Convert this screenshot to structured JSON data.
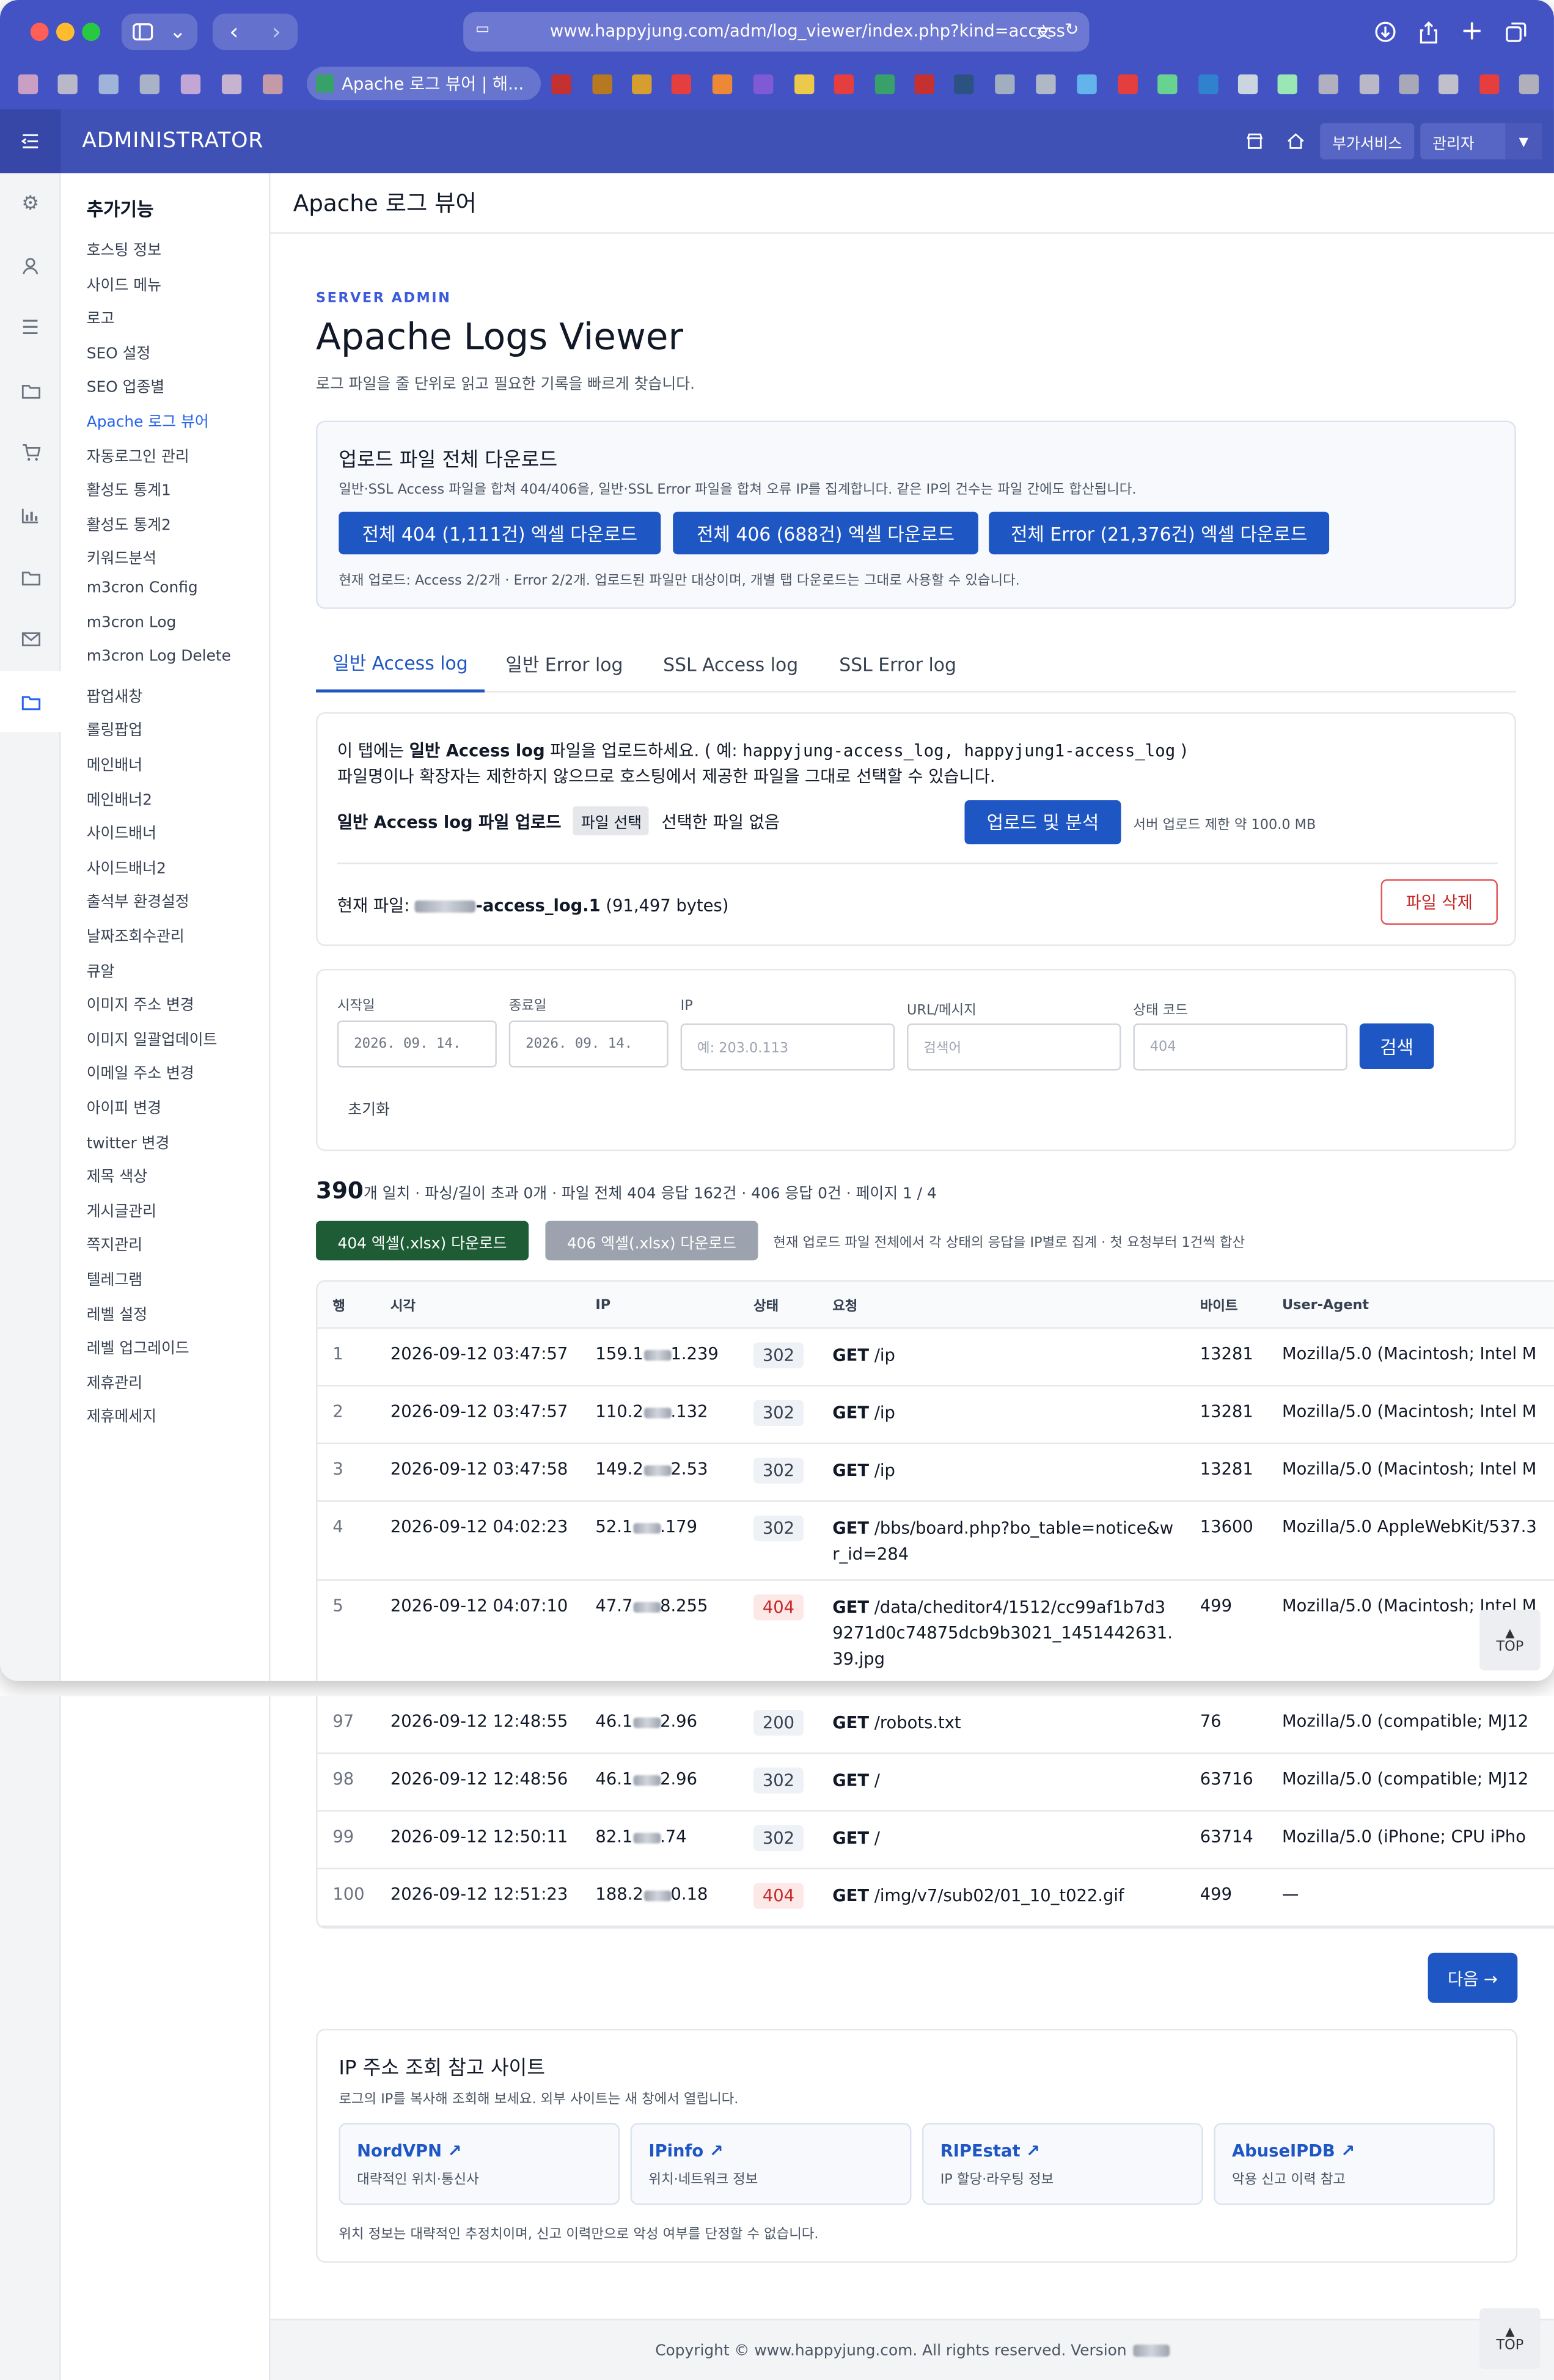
{
  "browser": {
    "url": "www.happyjung.com/adm/log_viewer/index.php?kind=access",
    "active_tab": "Apache 로그 뷰어 | 해..."
  },
  "admin": {
    "title": "ADMINISTRATOR",
    "services_label": "부가서비스",
    "user_label": "관리자"
  },
  "sidebar": {
    "heading": "추가기능",
    "items": [
      "호스팅 정보",
      "사이드 메뉴",
      "로고",
      "SEO 설정",
      "SEO 업종별",
      "Apache 로그 뷰어",
      "자동로그인 관리",
      "활성도 통계1",
      "활성도 통계2",
      "키워드분석",
      "m3cron Config",
      "m3cron Log",
      "m3cron Log Delete",
      "팝업새창",
      "롤링팝업",
      "메인배너",
      "메인배너2",
      "사이드배너",
      "사이드배너2",
      "출석부 환경설정",
      "날짜조회수관리",
      "큐알",
      "이미지 주소 변경",
      "이미지 일괄업데이트",
      "이메일 주소 변경",
      "아이피 변경",
      "twitter 변경",
      "제목 색상",
      "게시글관리",
      "쪽지관리",
      "텔레그램",
      "레벨 설정",
      "레벨 업그레이드",
      "제휴관리",
      "제휴메세지"
    ],
    "active_index": 5
  },
  "page": {
    "header_title": "Apache 로그 뷰어",
    "kicker": "SERVER ADMIN",
    "title": "Apache Logs Viewer",
    "lead": "로그 파일을 줄 단위로 읽고 필요한 기록을 빠르게 찾습니다."
  },
  "download_all": {
    "title": "업로드 파일 전체 다운로드",
    "desc": "일반·SSL Access 파일을 합쳐 404/406을, 일반·SSL Error 파일을 합쳐 오류 IP를 집계합니다. 같은 IP의 건수는 파일 간에도 합산됩니다.",
    "btn_404": "전체 404 (1,111건) 엑셀 다운로드",
    "btn_406": "전체 406 (688건) 엑셀 다운로드",
    "btn_error": "전체 Error (21,376건) 엑셀 다운로드",
    "note": "현재 업로드: Access 2/2개 · Error 2/2개. 업로드된 파일만 대상이며, 개별 탭 다운로드는 그대로 사용할 수 있습니다."
  },
  "tabs": [
    "일반 Access log",
    "일반 Error log",
    "SSL Access log",
    "SSL Error log"
  ],
  "upload": {
    "line1_pre": "이 탭에는 ",
    "line1_bold": "일반 Access log",
    "line1_mid": " 파일을 업로드하세요. ( 예: ",
    "line1_mono": "happyjung-access_log, happyjung1-access_log",
    "line1_post": " )",
    "line2": "파일명이나 확장자는 제한하지 않으므로 호스팅에서 제공한 파일을 그대로 선택할 수 있습니다.",
    "label": "일반 Access log 파일 업로드",
    "file_button": "파일 선택",
    "no_file": "선택한 파일 없음",
    "submit": "업로드 및 분석",
    "limit": "서버 업로드 제한 약 100.0 MB",
    "current_label": "현재 파일: ",
    "current_file": "-access_log.1",
    "current_size": " (91,497 bytes)",
    "delete": "파일 삭제"
  },
  "filters": {
    "start_label": "시작일",
    "start_value": "2026. 09. 14.",
    "end_label": "종료일",
    "end_value": "2026. 09. 14.",
    "ip_label": "IP",
    "ip_placeholder": "예: 203.0.113",
    "url_label": "URL/메시지",
    "url_placeholder": "검색어",
    "status_label": "상태 코드",
    "status_placeholder": "404",
    "search": "검색",
    "reset": "초기화"
  },
  "summary": {
    "count": "390",
    "text": "개 일치 · 파싱/길이 초과 0개 · 파일 전체 404 응답 162건 · 406 응답 0건 · 페이지 1 / 4"
  },
  "excel": {
    "btn_404": "404 엑셀(.xlsx) 다운로드",
    "btn_406": "406 엑셀(.xlsx) 다운로드",
    "note": "현재 업로드 파일 전체에서 각 상태의 응답을 IP별로 집계 · 첫 요청부터 1건씩 합산"
  },
  "table": {
    "headers": [
      "행",
      "시각",
      "IP",
      "상태",
      "요청",
      "바이트",
      "User-Agent"
    ],
    "rows_top": [
      {
        "idx": "1",
        "time": "2026-09-12 03:47:57",
        "ip_a": "159.1",
        "ip_b": "1.239",
        "status": "302",
        "method": "GET",
        "path": "/ip",
        "bytes": "13281",
        "ua": "Mozilla/5.0 (Macintosh; Intel M"
      },
      {
        "idx": "2",
        "time": "2026-09-12 03:47:57",
        "ip_a": "110.2",
        "ip_b": ".132",
        "status": "302",
        "method": "GET",
        "path": "/ip",
        "bytes": "13281",
        "ua": "Mozilla/5.0 (Macintosh; Intel M"
      },
      {
        "idx": "3",
        "time": "2026-09-12 03:47:58",
        "ip_a": "149.2",
        "ip_b": "2.53",
        "status": "302",
        "method": "GET",
        "path": "/ip",
        "bytes": "13281",
        "ua": "Mozilla/5.0 (Macintosh; Intel M"
      },
      {
        "idx": "4",
        "time": "2026-09-12 04:02:23",
        "ip_a": "52.1",
        "ip_b": ".179",
        "status": "302",
        "method": "GET",
        "path": "/bbs/board.php?bo_table=notice&wr_id=284",
        "bytes": "13600",
        "ua": "Mozilla/5.0 AppleWebKit/537.3"
      },
      {
        "idx": "5",
        "time": "2026-09-12 04:07:10",
        "ip_a": "47.7",
        "ip_b": "8.255",
        "status": "404",
        "method": "GET",
        "path": "/data/cheditor4/1512/cc99af1b7d39271d0c74875dcb9b3021_1451442631.39.jpg",
        "bytes": "499",
        "ua": "Mozilla/5.0 (Macintosh; Intel M"
      }
    ],
    "rows_bottom": [
      {
        "idx": "97",
        "time": "2026-09-12 12:48:55",
        "ip_a": "46.1",
        "ip_b": "2.96",
        "status": "200",
        "method": "GET",
        "path": "/robots.txt",
        "bytes": "76",
        "ua": "Mozilla/5.0 (compatible; MJ12"
      },
      {
        "idx": "98",
        "time": "2026-09-12 12:48:56",
        "ip_a": "46.1",
        "ip_b": "2.96",
        "status": "302",
        "method": "GET",
        "path": "/",
        "bytes": "63716",
        "ua": "Mozilla/5.0 (compatible; MJ12"
      },
      {
        "idx": "99",
        "time": "2026-09-12 12:50:11",
        "ip_a": "82.1",
        "ip_b": ".74",
        "status": "302",
        "method": "GET",
        "path": "/",
        "bytes": "63714",
        "ua": "Mozilla/5.0 (iPhone; CPU iPho"
      },
      {
        "idx": "100",
        "time": "2026-09-12 12:51:23",
        "ip_a": "188.2",
        "ip_b": "0.18",
        "status": "404",
        "method": "GET",
        "path": "/img/v7/sub02/01_10_t022.gif",
        "bytes": "499",
        "ua": "—"
      }
    ]
  },
  "next_label": "다음 →",
  "top_label": "TOP",
  "ip_ref": {
    "title": "IP 주소 조회 참고 사이트",
    "desc": "로그의 IP를 복사해 조회해 보세요. 외부 사이트는 새 창에서 열립니다.",
    "sites": [
      {
        "name": "NordVPN ↗",
        "sub": "대략적인 위치·통신사"
      },
      {
        "name": "IPinfo ↗",
        "sub": "위치·네트워크 정보"
      },
      {
        "name": "RIPEstat ↗",
        "sub": "IP 할당·라우팅 정보"
      },
      {
        "name": "AbuseIPDB ↗",
        "sub": "악용 신고 이력 참고"
      }
    ],
    "note": "위치 정보는 대략적인 추정치이며, 신고 이력만으로 악성 여부를 단정할 수 없습니다."
  },
  "footer": "Copyright © www.happyjung.com. All rights reserved. Version"
}
